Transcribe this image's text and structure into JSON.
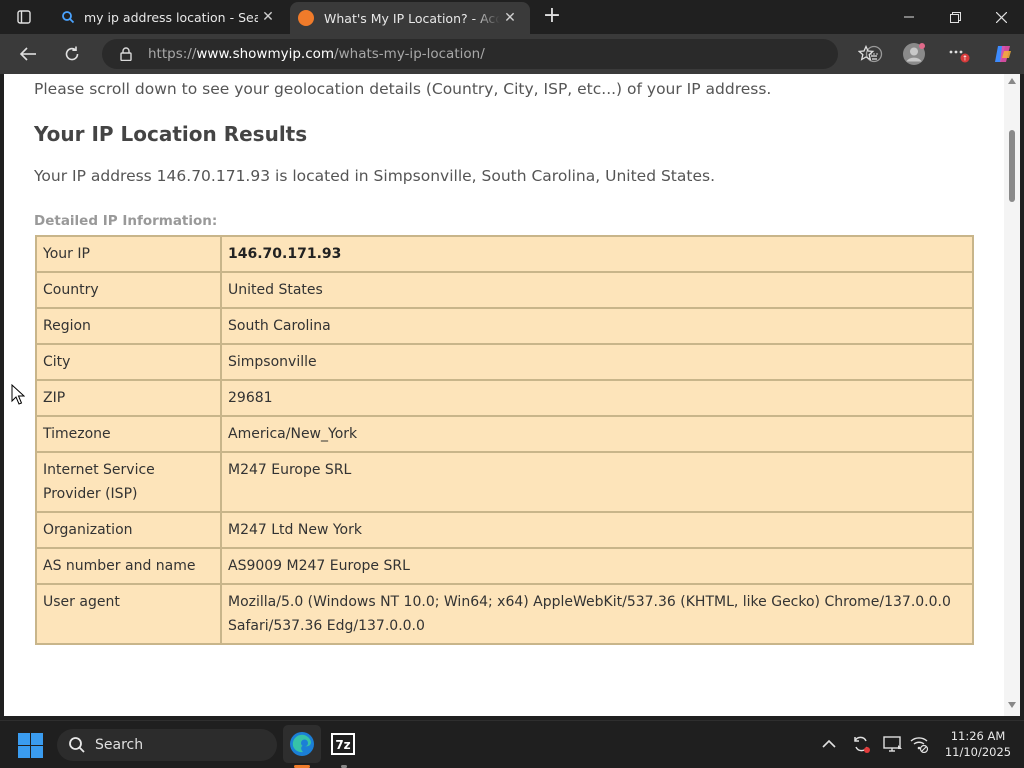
{
  "browser": {
    "tabs": [
      {
        "label": "my ip address location - Search"
      },
      {
        "label": "What's My IP Location? - Accurate"
      }
    ],
    "url": {
      "prefix": "https://",
      "host": "www.showmyip.com",
      "path": "/whats-my-ip-location/"
    }
  },
  "page": {
    "intro": "Please scroll down to see your geolocation details (Country, City, ISP, etc...) of your IP address.",
    "heading": "Your IP Location Results",
    "summary": "Your IP address 146.70.171.93 is located in Simpsonville, South Carolina, United States.",
    "detail_label": "Detailed IP Information:",
    "table": [
      {
        "key": "Your IP",
        "value": "146.70.171.93"
      },
      {
        "key": "Country",
        "value": "United States"
      },
      {
        "key": "Region",
        "value": "South Carolina"
      },
      {
        "key": "City",
        "value": "Simpsonville"
      },
      {
        "key": "ZIP",
        "value": "29681"
      },
      {
        "key": "Timezone",
        "value": "America/New_York"
      },
      {
        "key": "Internet Service Provider (ISP)",
        "value": "M247 Europe SRL"
      },
      {
        "key": "Organization",
        "value": "M247 Ltd New York"
      },
      {
        "key": "AS number and name",
        "value": "AS9009 M247 Europe SRL"
      },
      {
        "key": "User agent",
        "value": "Mozilla/5.0 (Windows NT 10.0; Win64; x64) AppleWebKit/537.36 (KHTML, like Gecko) Chrome/137.0.0.0 Safari/537.36 Edg/137.0.0.0"
      }
    ]
  },
  "taskbar": {
    "search_label": "Search",
    "time": "11:26 AM",
    "date": "11/10/2025"
  },
  "colors": {
    "table_bg": "#fde4ba",
    "table_border": "#c8b58a",
    "favicon": "#f07b2a",
    "windows_accent": "#3a9cf0"
  }
}
